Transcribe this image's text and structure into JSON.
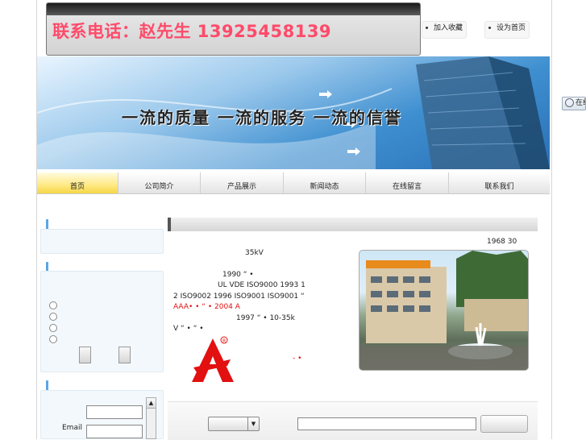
{
  "header": {
    "title": "联系电话：赵先生 13925458139",
    "add_favorite": "加入收藏",
    "set_homepage": "设为首页"
  },
  "banner": {
    "slogan": "一流的质量 一流的服务 一流的信誉"
  },
  "nav": {
    "items": [
      {
        "label": "首页"
      },
      {
        "label": "公司简介"
      },
      {
        "label": "产品展示"
      },
      {
        "label": "新闻动态"
      },
      {
        "label": "在线留言"
      },
      {
        "label": "联系我们"
      }
    ]
  },
  "sidebar": {
    "email_label": "Email"
  },
  "content": {
    "lines": [
      "1968    30",
      "35kV",
      "1990                                    “ •",
      "UL   VDE            ISO9000          1993 1",
      "2   ISO9002       1996   ISO9001          ISO9001           “",
      "AAA• •       “          •      2004      A",
      "1997                                  “      •   10-35k",
      "V                “          •           “                  •",
      "-                  •"
    ]
  },
  "side_tab": {
    "label": "在线留言"
  },
  "colors": {
    "title_red": "#ff4a6a",
    "accent_blue": "#5aa6e6",
    "nav_active": "#ffe985",
    "logo_red": "#e21010"
  }
}
